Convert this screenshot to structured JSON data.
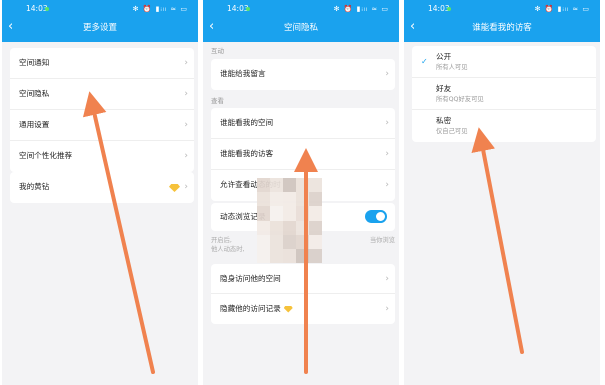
{
  "status_bar": {
    "time": "14:03",
    "icons": "✻ ⏰ ▮ᵢₗₗ ≈ ▭"
  },
  "screen1": {
    "title": "更多设置",
    "group1": [
      "空间通知",
      "空间隐私",
      "通用设置",
      "空间个性化推荐"
    ],
    "group2": [
      "我的黄钻"
    ]
  },
  "screen2": {
    "title": "空间隐私",
    "section_interact": "互动",
    "interact_items": [
      "谁能给我留言"
    ],
    "section_view": "查看",
    "view_items": [
      "谁能看我的空间",
      "谁能看我的访客",
      "允许查看动态的时"
    ],
    "toggle_label": "动态浏览记录",
    "toggle_on": true,
    "note_line1": "开启后,",
    "note_line1_right": "当你浏览",
    "note_line2": "他人动态时,",
    "other_items": [
      "隐身访问他的空间",
      "隐藏他的访问记录"
    ]
  },
  "screen3": {
    "title": "谁能看我的访客",
    "options": [
      {
        "name": "公开",
        "desc": "所有人可见",
        "selected": true
      },
      {
        "name": "好友",
        "desc": "所有QQ好友可见",
        "selected": false
      },
      {
        "name": "私密",
        "desc": "仅自己可见",
        "selected": false
      }
    ]
  },
  "colors": {
    "header": "#1aa2ee",
    "arrow": "#f0824f",
    "toggle": "#1aa2ee",
    "diamond": "#f6c23b"
  },
  "icons": {
    "back": "chevron-left-icon",
    "row_arrow": "chevron-right-icon",
    "check": "check-icon",
    "vip": "diamond-icon"
  }
}
